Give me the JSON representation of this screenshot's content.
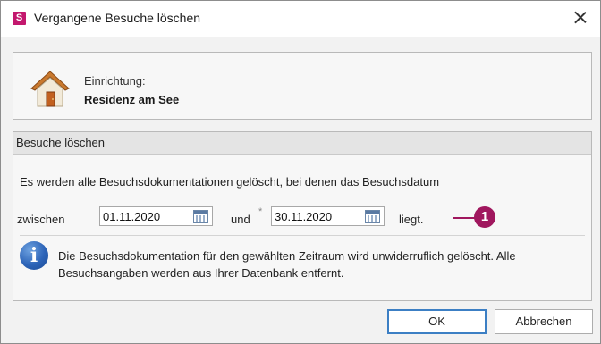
{
  "window": {
    "app_icon_letter": "S",
    "title": "Vergangene Besuche löschen",
    "close_icon": "close-icon"
  },
  "facility": {
    "label": "Einrichtung:",
    "value": "Residenz am See",
    "icon": "house-icon"
  },
  "group": {
    "title": "Besuche löschen",
    "description": "Es werden alle Besuchsdokumentationen gelöscht, bei denen das Besuchsdatum",
    "between_label": "zwischen",
    "from_date": "01.11.2020",
    "and_label": "und",
    "required_marker": "*",
    "to_date": "30.11.2020",
    "lies_label": "liegt.",
    "callout_number": "1",
    "info_icon_glyph": "i",
    "info_text": "Die Besuchsdokumentation für den gewählten Zeitraum wird unwiderruflich gelöscht. Alle Besuchsangaben werden aus Ihrer Datenbank entfernt."
  },
  "buttons": {
    "ok": "OK",
    "cancel": "Abbrechen"
  },
  "colors": {
    "brand": "#c3186e",
    "callout": "#a0175e",
    "focus_border": "#3c7fc4"
  }
}
